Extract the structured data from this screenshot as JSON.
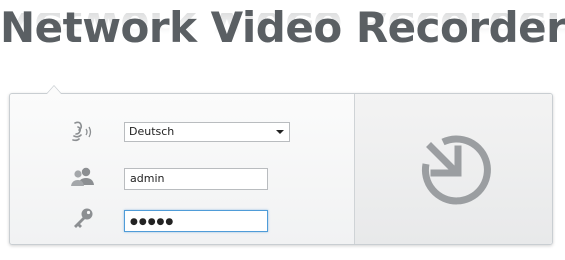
{
  "header": {
    "title": "Network Video Recorder"
  },
  "login": {
    "language": {
      "icon": "language-speaker-icon",
      "selected": "Deutsch"
    },
    "username": {
      "icon": "users-icon",
      "value": "admin"
    },
    "password": {
      "icon": "key-icon",
      "value": "●●●●●"
    },
    "submit": {
      "icon": "login-clock-arrow-icon"
    }
  },
  "colors": {
    "title": "#5a5f63",
    "icon": "#8c8f92",
    "focus_border": "#4f9cd8"
  }
}
